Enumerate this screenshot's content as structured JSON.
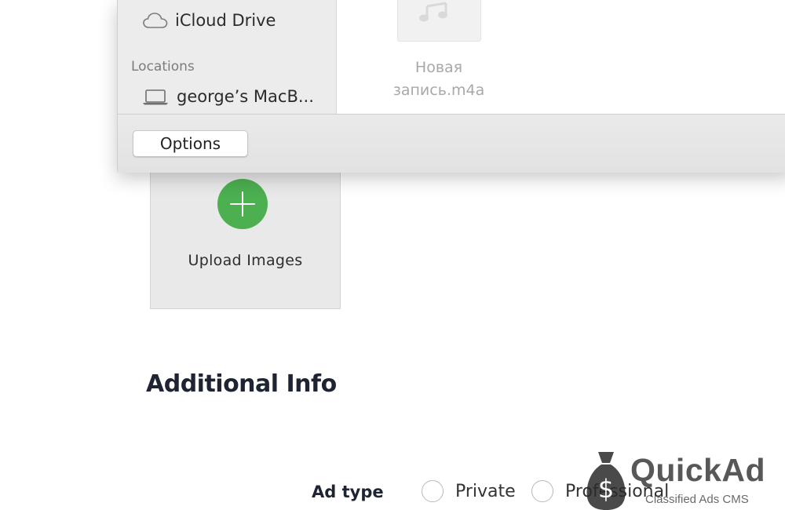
{
  "dialog": {
    "sidebar": {
      "favorites": [
        {
          "label": "iCloud Drive",
          "icon": "cloud-icon"
        }
      ],
      "locations_heading": "Locations",
      "locations": [
        {
          "label": "george’s MacB...",
          "icon": "laptop-icon"
        }
      ]
    },
    "file": {
      "name_line1": "Новая",
      "name_line2": "запись.m4a",
      "icon": "music-note-icon"
    },
    "options_label": "Options"
  },
  "upload": {
    "label": "Upload Images",
    "accent": "#4caf50"
  },
  "additional_info": {
    "title": "Additional Info",
    "ad_type_label": "Ad type",
    "options": [
      "Private",
      "Professional"
    ]
  },
  "watermark": {
    "brand": "QuickAd",
    "tagline": "Classified Ads CMS",
    "icon": "money-bag-icon"
  }
}
